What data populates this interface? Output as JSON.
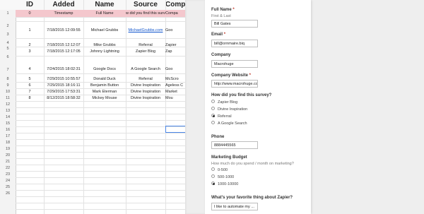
{
  "sheet": {
    "headers": [
      "ID",
      "Added",
      "Name",
      "Source",
      "Comp"
    ],
    "row_numbers": [
      "1",
      "2",
      "3",
      "4",
      "5",
      "6",
      "7",
      "8",
      "9",
      "10",
      "11",
      "12",
      "13",
      "14",
      "15",
      "16",
      "17",
      "18",
      "19",
      "20",
      "21",
      "22",
      "23",
      "24",
      "25",
      "26"
    ],
    "header_row": [
      "0",
      "Timestamp",
      "Full Name",
      "w did you find this surve",
      "Compa"
    ],
    "rows": [
      [
        "1",
        "7/18/2015 12:09:55",
        "Michael Grubbs",
        "MichaelGrubbs.com",
        "Goo"
      ],
      [
        "2",
        "7/18/2015 12:12:07",
        "Mike Grubbs",
        "Referral",
        "Zapier"
      ],
      [
        "3",
        "7/18/2015 12:17:05",
        "Johnny Lightning",
        "Zapier Blog",
        "Zap"
      ],
      [
        "4",
        "7/24/2015 18:02:31",
        "Google Docs",
        "A Google Search",
        "Goo"
      ],
      [
        "5",
        "7/29/2015 10:55:57",
        "Donald Duck",
        "Referral",
        "McScro"
      ],
      [
        "6",
        "7/29/2015 18:16:11",
        "Benjamin Button",
        "Divine Inspiration",
        "Ageless C"
      ],
      [
        "7",
        "7/29/2015 17:53:31",
        "Mark Eterman",
        "Divine Inspiration",
        "Market"
      ],
      [
        "8",
        "8/12/2015 18:58:32",
        "Mickey Mouse",
        "Divine Inspiration",
        "Mou"
      ]
    ]
  },
  "form": {
    "full_name": {
      "label": "Full Name",
      "sub": "First & Last",
      "value": "Bill Gates"
    },
    "email": {
      "label": "Email",
      "value": "bill@ornmaire.biq"
    },
    "company": {
      "label": "Company",
      "value": "Macrohuge"
    },
    "website": {
      "label": "Company Website",
      "value": "http://www.macrohuge.co"
    },
    "survey": {
      "label": "How did you find this survey?",
      "options": [
        "Zapier Blog",
        "Divine Inspiration",
        "Referral",
        "A Google Search"
      ]
    },
    "phone": {
      "label": "Phone",
      "value": "8884445565"
    },
    "budget": {
      "label": "Marketing Budget",
      "sub": "How much do you spend / month on marketing?",
      "options": [
        "0-500",
        "500-1000",
        "1000-10000"
      ]
    },
    "favorite": {
      "label": "What's your favorite thing about Zapier?",
      "value": "I like to automate my ..."
    },
    "required_mark": "*"
  }
}
